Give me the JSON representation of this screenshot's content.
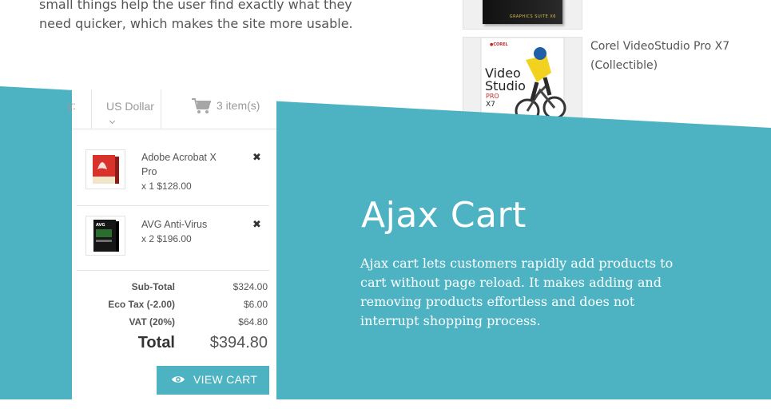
{
  "intro": {
    "text": "small things help the user find exactly what they need quicker, which makes the site more usable."
  },
  "products": [
    {
      "name": "",
      "box_text": "GRAPHICS SUITE X6",
      "icon": "graphics-suite-box-image"
    },
    {
      "name": "Corel VideoStudio Pro X7 (Collectible)",
      "box_text": "Video Studio PRO X7",
      "icon": "corel-videostudio-box-image"
    }
  ],
  "cart": {
    "language_fragment": "y:",
    "currency": "US Dollar",
    "items_count": "3 item(s)",
    "items": [
      {
        "name": "Adobe Acrobat X Pro",
        "qty_price": "x 1 $128.00",
        "icon": "acrobat-box-image"
      },
      {
        "name": "AVG Anti-Virus",
        "qty_price": "x 2 $196.00",
        "icon": "avg-box-image"
      }
    ],
    "remove_glyph": "✖",
    "totals": [
      {
        "label": "Sub-Total",
        "value": "$324.00"
      },
      {
        "label": "Eco Tax (-2.00)",
        "value": "$6.00"
      },
      {
        "label": "VAT (20%)",
        "value": "$64.80"
      },
      {
        "label": "Total",
        "value": "$394.80"
      }
    ],
    "view_cart_label": "VIEW CART"
  },
  "feature": {
    "title": "Ajax Cart",
    "description": "Ajax cart lets customers rapidly add products to cart without page reload. It makes adding and removing products effortless and does not interrupt shopping process."
  },
  "colors": {
    "accent": "#4db3c3",
    "text_gray": "#555555",
    "muted_gray": "#999999"
  }
}
